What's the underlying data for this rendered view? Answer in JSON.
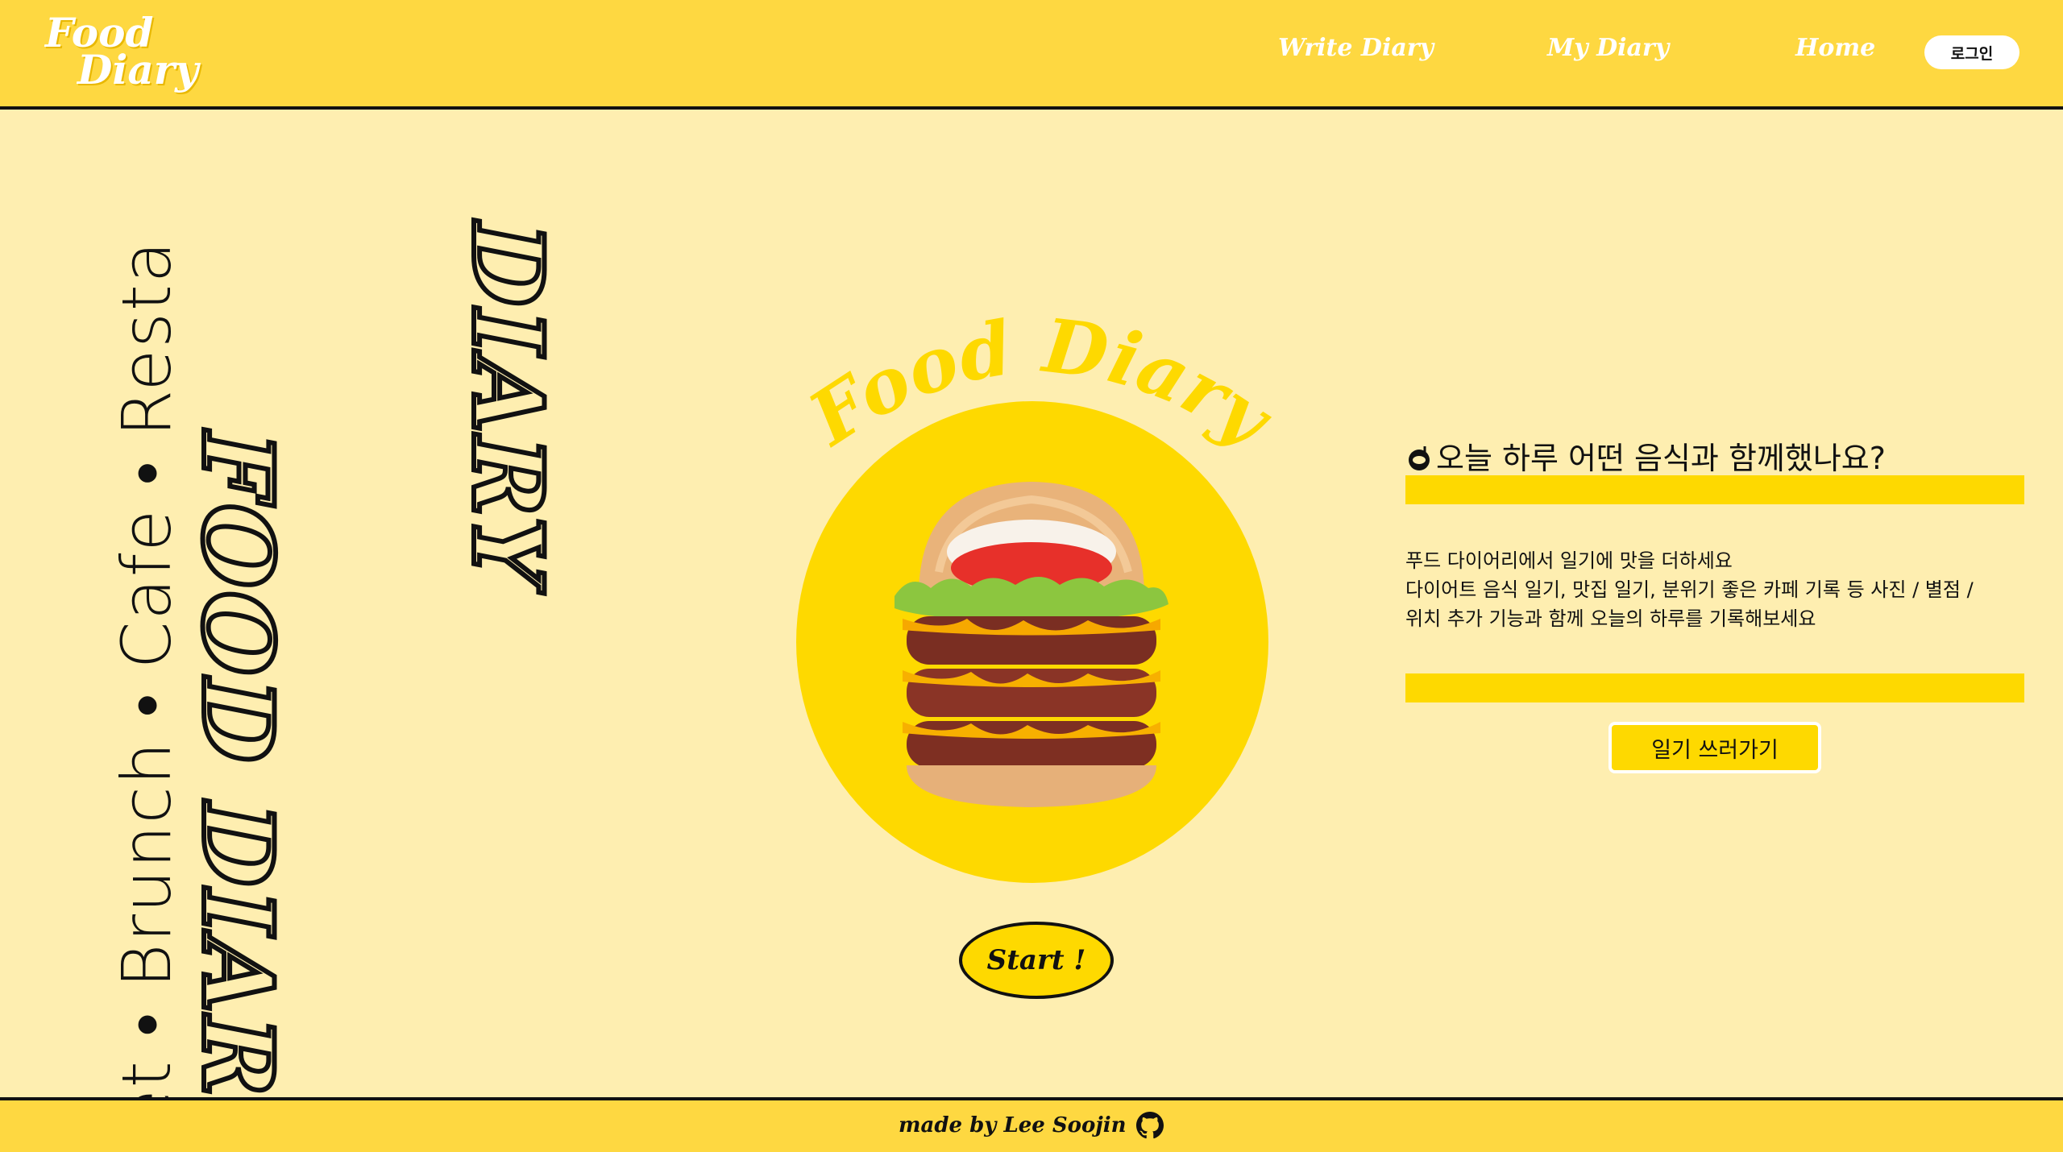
{
  "header": {
    "logo_line1": "Food",
    "logo_line2": "Diary",
    "nav": [
      "Write Diary",
      "My Diary",
      "Home"
    ],
    "login_label": "로그인"
  },
  "left": {
    "categories": "Diet • Brunch • Cafe • Resta",
    "food_diary": "FOOD DIARY",
    "diary_top": "DIARY"
  },
  "center": {
    "arc_title": "Food Diary",
    "start_label": "Start !"
  },
  "right": {
    "question": "오늘 하루 어떤 음식과 함께했나요?",
    "desc_lines": [
      "푸드 다이어리에서 일기에 맛을 더하세요",
      "다이어트 음식 일기, 맛집 일기, 분위기 좋은 카페 기록 등 사진 / 별점 /",
      "위치 추가 기능과 함께 오늘의 하루를 기록해보세요"
    ],
    "write_button": "일기 쓰러가기"
  },
  "footer": {
    "credit": "made by Lee Soojin"
  },
  "colors": {
    "header_bg": "#fed841",
    "page_bg": "#feeeb0",
    "accent_yellow": "#fed900",
    "arc_title": "#fed900"
  },
  "icons": {
    "question": "plate-icon",
    "footer": "github-icon"
  }
}
